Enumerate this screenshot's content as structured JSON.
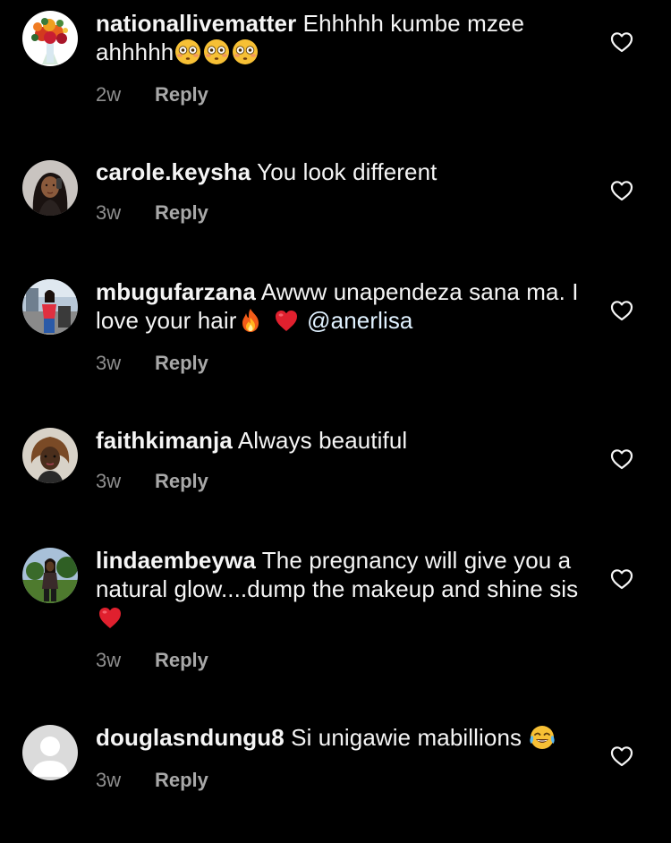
{
  "comments": [
    {
      "username": "nationallivematter",
      "text": "Ehhhhh kumbe mzee ahhhhh",
      "emojis": [
        "flushed-face",
        "flushed-face",
        "flushed-face"
      ],
      "time": "2w",
      "reply": "Reply"
    },
    {
      "username": "carole.keysha",
      "text": "You look different",
      "time": "3w",
      "reply": "Reply"
    },
    {
      "username": "mbugufarzana",
      "text": "Awww unapendeza sana ma. I love your hair",
      "emojis": [
        "fire",
        "red-heart"
      ],
      "mention": "@anerlisa",
      "time": "3w",
      "reply": "Reply"
    },
    {
      "username": "faithkimanja",
      "text": "Always beautiful",
      "time": "3w",
      "reply": "Reply"
    },
    {
      "username": "lindaembeywa",
      "text": "The pregnancy will give you a natural glow....dump the makeup and shine sis",
      "emojis": [
        "red-heart"
      ],
      "time": "3w",
      "reply": "Reply"
    },
    {
      "username": "douglasndungu8",
      "text": "Si unigawie mabillions",
      "emojis": [
        "face-with-tears-of-joy"
      ],
      "time": "3w",
      "reply": "Reply"
    }
  ],
  "icons": {
    "like": "heart-outline-icon"
  },
  "colors": {
    "background": "#000000",
    "text": "#f5f5f5",
    "meta": "#8e8e8e"
  }
}
